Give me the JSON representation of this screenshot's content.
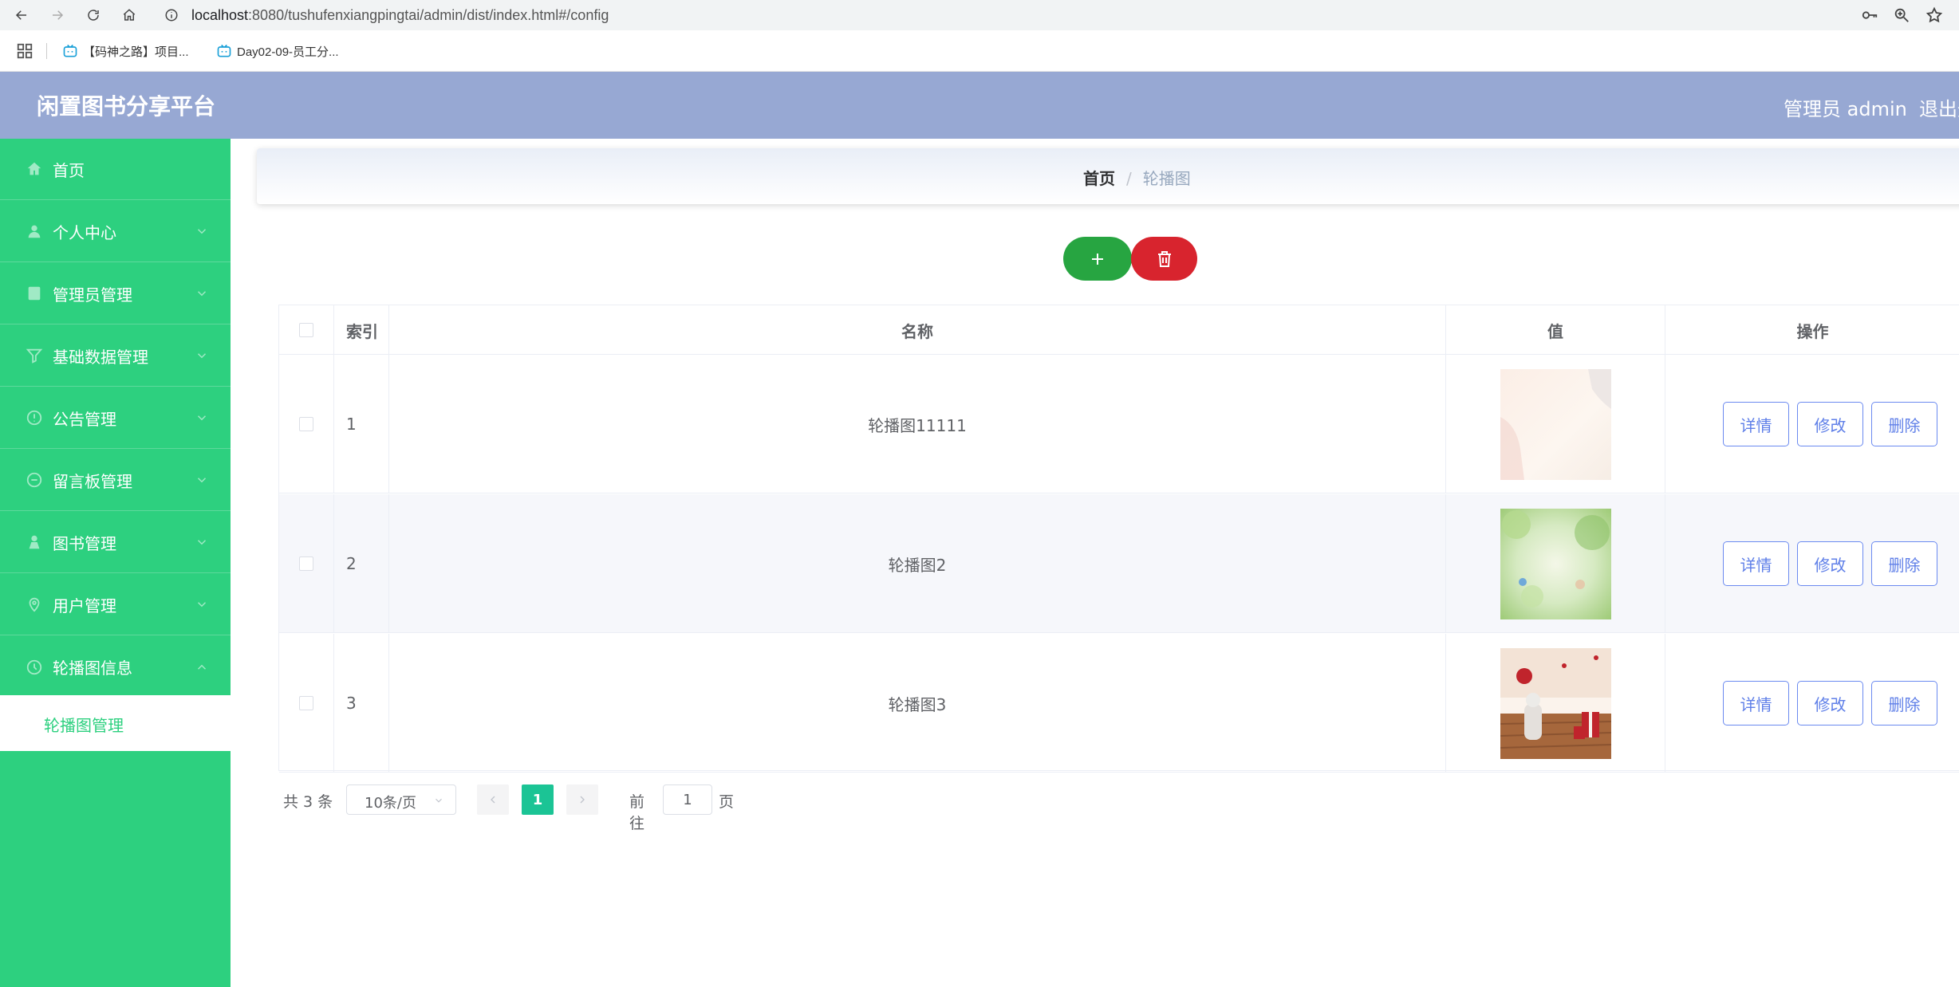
{
  "browser": {
    "url_host": "localhost",
    "url_rest": ":8080/tushufenxiangpingtai/admin/dist/index.html#/config",
    "bookmarks": [
      "【码神之路】项目...",
      "Day02-09-员工分..."
    ]
  },
  "header": {
    "title": "闲置图书分享平台",
    "user": "管理员 admin",
    "logout": "退出登"
  },
  "sidebar": {
    "items": [
      {
        "label": "首页",
        "icon": "home-icon"
      },
      {
        "label": "个人中心",
        "icon": "user-icon"
      },
      {
        "label": "管理员管理",
        "icon": "admin-icon"
      },
      {
        "label": "基础数据管理",
        "icon": "filter-icon"
      },
      {
        "label": "公告管理",
        "icon": "notice-icon"
      },
      {
        "label": "留言板管理",
        "icon": "message-icon"
      },
      {
        "label": "图书管理",
        "icon": "book-icon"
      },
      {
        "label": "用户管理",
        "icon": "users-icon"
      },
      {
        "label": "轮播图信息",
        "icon": "carousel-icon"
      }
    ],
    "active_sub": "轮播图管理"
  },
  "breadcrumb": {
    "home": "首页",
    "separator": "/",
    "current": "轮播图"
  },
  "table": {
    "headers": {
      "index": "索引",
      "name": "名称",
      "value": "值",
      "ops": "操作"
    },
    "rows": [
      {
        "index": "1",
        "name": "轮播图11111",
        "thumb": "pale-floral-thumbnail"
      },
      {
        "index": "2",
        "name": "轮播图2",
        "thumb": "green-bokeh-thumbnail"
      },
      {
        "index": "3",
        "name": "轮播图3",
        "thumb": "gift-scene-thumbnail"
      }
    ],
    "ops": {
      "detail": "详情",
      "edit": "修改",
      "delete": "删除"
    }
  },
  "pagination": {
    "total": "共 3 条",
    "page_size": "10条/页",
    "current_page": "1",
    "goto_label": "前往",
    "goto_value": "1",
    "page_unit": "页"
  },
  "colors": {
    "sidebar": "#2dd07f",
    "header": "#97a8d3",
    "add": "#27a541",
    "delete": "#d8242e",
    "pager_active": "#1bc495"
  }
}
